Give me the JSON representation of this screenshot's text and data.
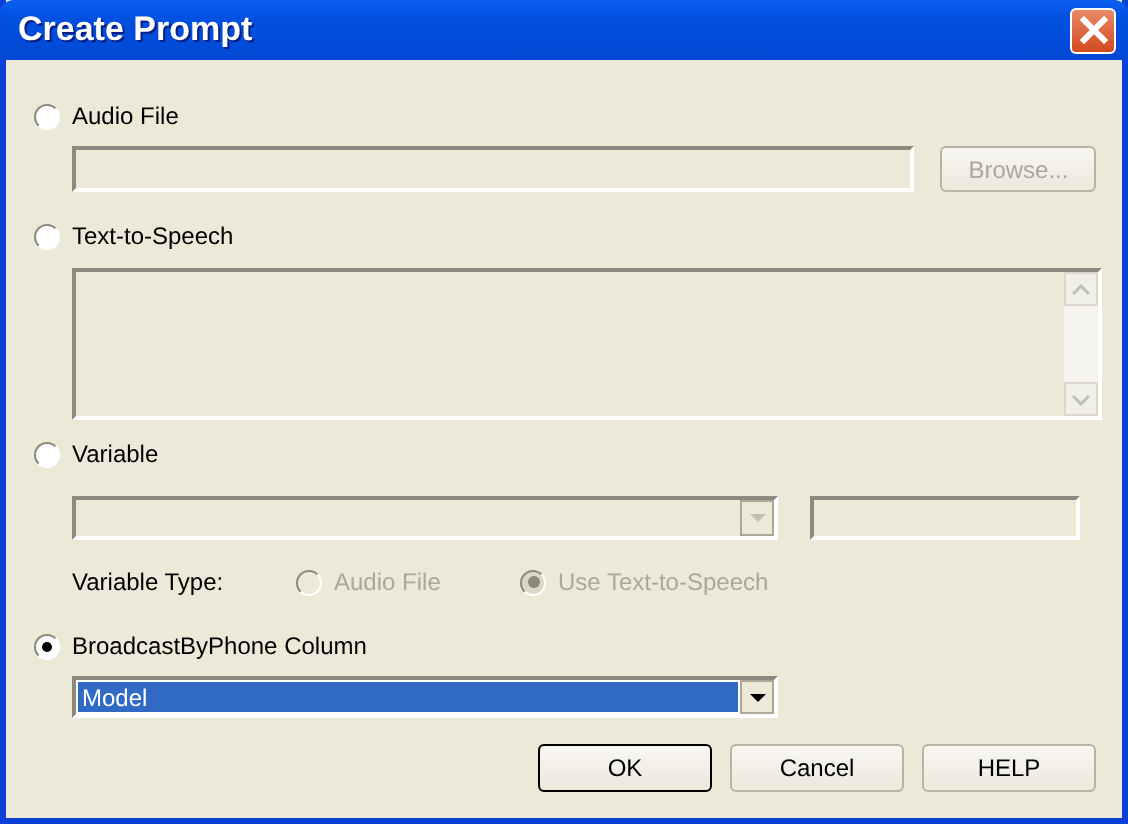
{
  "window": {
    "title": "Create Prompt"
  },
  "audio_file": {
    "label": "Audio File",
    "selected": false,
    "browse_button": {
      "label": "Browse...",
      "disabled": true
    }
  },
  "text_to_speech": {
    "label": "Text-to-Speech",
    "selected": false
  },
  "variable": {
    "label": "Variable",
    "selected": false,
    "variable_type": {
      "label": "Variable Type:",
      "options": [
        {
          "label": "Audio File",
          "selected": false,
          "disabled": true
        },
        {
          "label": "Use Text-to-Speech",
          "selected": true,
          "disabled": true
        }
      ]
    }
  },
  "column": {
    "label": "BroadcastByPhone Column",
    "selected": true,
    "dropdown": {
      "value": "Model",
      "highlighted": true
    }
  },
  "buttons": [
    {
      "label": "OK",
      "default": true
    },
    {
      "label": "Cancel",
      "default": false
    },
    {
      "label": "HELP",
      "default": false
    }
  ]
}
